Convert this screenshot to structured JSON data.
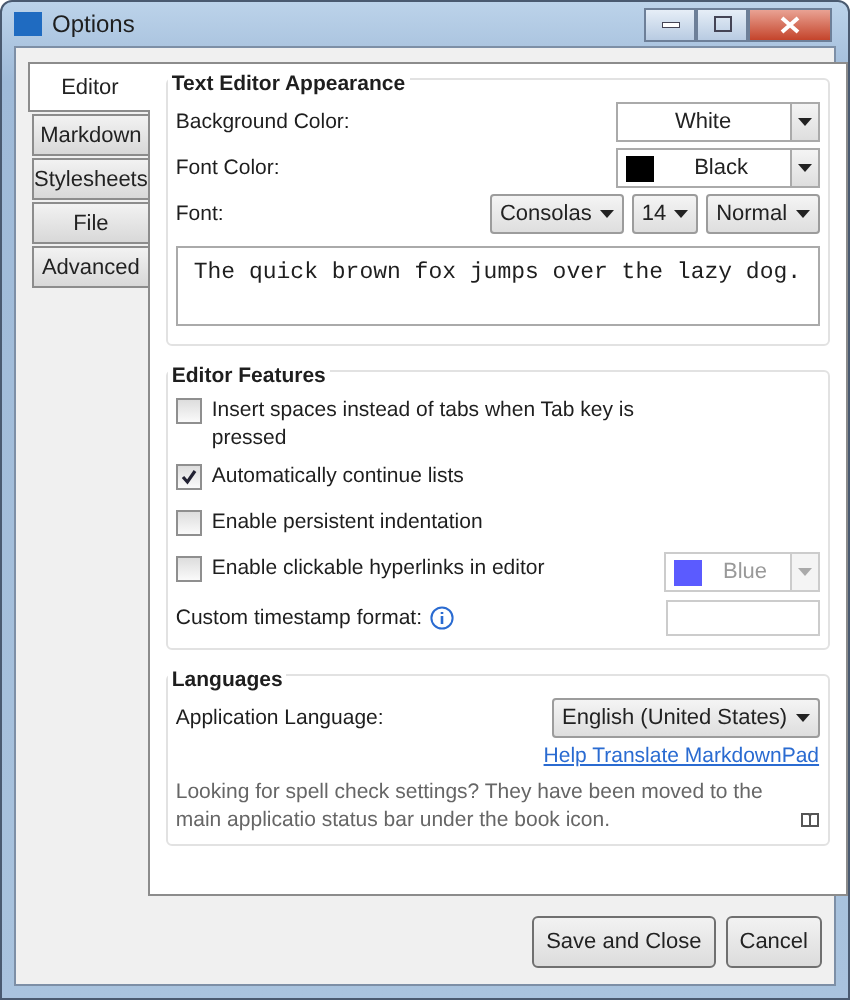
{
  "window": {
    "title": "Options"
  },
  "tabs": [
    {
      "label": "Editor",
      "selected": true
    },
    {
      "label": "Markdown",
      "selected": false
    },
    {
      "label": "Stylesheets",
      "selected": false
    },
    {
      "label": "File",
      "selected": false
    },
    {
      "label": "Advanced",
      "selected": false
    }
  ],
  "appearance": {
    "title": "Text Editor Appearance",
    "background_color": {
      "label": "Background Color:",
      "value": "White"
    },
    "font_color": {
      "label": "Font Color:",
      "value": "Black",
      "color": "#000000"
    },
    "font": {
      "label": "Font:",
      "family": "Consolas",
      "size": "14",
      "style": "Normal"
    },
    "preview": "The quick brown fox jumps over the lazy dog."
  },
  "features": {
    "title": "Editor Features",
    "options": [
      {
        "label": "Insert spaces instead of tabs when Tab key is pressed",
        "checked": false
      },
      {
        "label": "Automatically continue lists",
        "checked": true
      },
      {
        "label": "Enable persistent indentation",
        "checked": false
      },
      {
        "label": "Enable clickable hyperlinks in editor",
        "checked": false
      }
    ],
    "link_color": {
      "value": "Blue",
      "color": "#5b5bff",
      "disabled": true
    },
    "timestamp": {
      "label": "Custom timestamp format:"
    }
  },
  "languages": {
    "title": "Languages",
    "label": "Application Language:",
    "value": "English (United States)",
    "link": "Help Translate MarkdownPad",
    "note": "Looking for spell check settings? They have been moved to the main applicatio status bar under the book icon."
  },
  "buttons": [
    "Save and Close",
    "Cancel"
  ]
}
